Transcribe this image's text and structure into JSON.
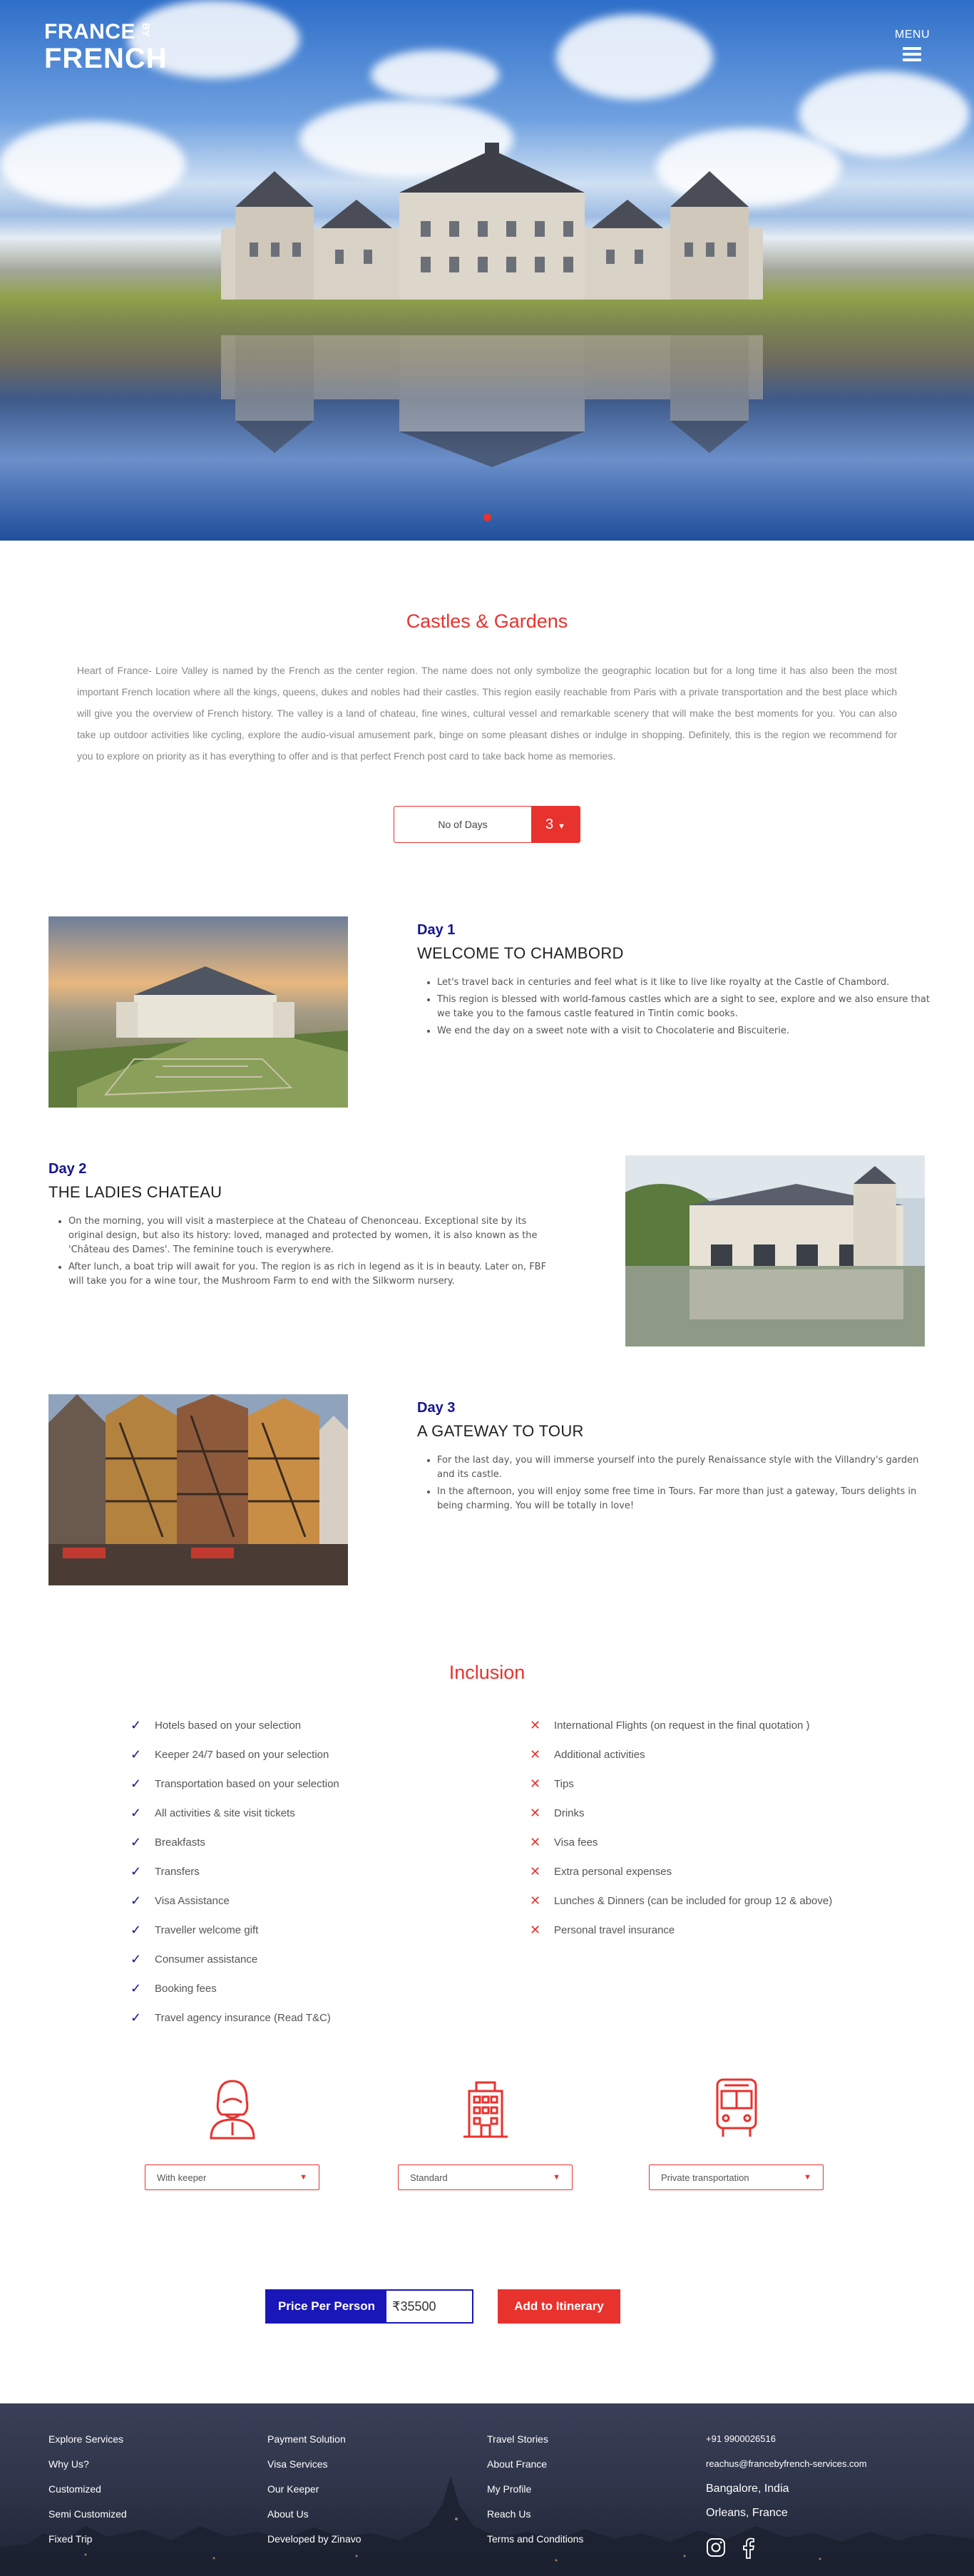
{
  "header": {
    "logo_line1": "FRANCE",
    "logo_by": "BY",
    "logo_line2": "FRENCH",
    "menu_label": "MENU"
  },
  "intro": {
    "title": "Castles & Gardens",
    "paragraph": "Heart of France- Loire Valley is named by the French as the center region. The name does not only symbolize the geographic location but for a long time it has also been the most important French location where all the kings, queens, dukes and nobles had their castles. This region easily reachable from Paris with a private transportation and the best place which will give you the overview of French history. The valley is a land of chateau, fine wines, cultural vessel and remarkable scenery that will make the best moments for you. You can also take up outdoor activities like cycling, explore the audio-visual amusement park, binge on some pleasant dishes or indulge in shopping. Definitely, this is the region we recommend for you to explore on priority as it has everything to offer and is that perfect French post card to take back home as memories.",
    "days_label": "No of Days",
    "days_value": "3"
  },
  "days": [
    {
      "num": "Day 1",
      "title": "WELCOME TO CHAMBORD",
      "bullets": [
        "Let's travel back in centuries and feel what is it like to live like royalty at the Castle of Chambord.",
        "This region is blessed with world-famous castles which are a sight to see, explore and we also ensure that we take you to the famous castle featured in Tintin comic books.",
        "We end the day on a sweet note with a visit to Chocolaterie and Biscuiterie."
      ]
    },
    {
      "num": "Day 2",
      "title": "THE LADIES CHATEAU",
      "bullets": [
        "On the morning, you will visit a masterpiece at the Chateau of Chenonceau. Exceptional site by its original design, but also its history: loved, managed and protected by women, it is also known as the 'Château des Dames'. The feminine touch is everywhere.",
        "After lunch, a boat trip will await for you. The region is as rich in legend as it is in beauty. Later on, FBF will take you for a wine tour, the Mushroom Farm to end with the Silkworm nursery."
      ]
    },
    {
      "num": "Day 3",
      "title": "A GATEWAY TO TOUR",
      "bullets": [
        "For the last day, you will immerse yourself into the purely Renaissance style with the Villandry's garden and its castle.",
        "In the afternoon, you will enjoy  some free time in Tours. Far more than just a gateway, Tours delights in being charming. You will be totally in love!"
      ]
    }
  ],
  "inclusion": {
    "title": "Inclusion",
    "included": [
      "Hotels based on your selection",
      "Keeper 24/7 based on your selection",
      "Transportation based on your selection",
      "All activities & site visit tickets",
      "Breakfasts",
      "Transfers",
      "Visa Assistance",
      "Traveller welcome gift",
      "Consumer assistance",
      "Booking fees",
      "Travel agency insurance (Read T&C)"
    ],
    "excluded": [
      "International Flights (on request in the final quotation )",
      "Additional activities",
      "Tips",
      "Drinks",
      "Visa fees",
      "Extra personal expenses",
      "Lunches & Dinners (can be included for group 12 & above)",
      "Personal travel insurance"
    ]
  },
  "options": {
    "keeper": "With keeper",
    "hotel": "Standard",
    "transport": "Private transportation"
  },
  "price": {
    "label": "Price Per Person",
    "value": "₹35500",
    "add_button": "Add to Itinerary"
  },
  "footer": {
    "col1": [
      "Explore Services",
      "Why Us?",
      "Customized",
      "Semi Customized",
      "Fixed Trip"
    ],
    "col2": [
      "Payment Solution",
      "Visa Services",
      "Our Keeper",
      "About Us",
      "Developed by Zinavo"
    ],
    "col3": [
      "Travel Stories",
      "About France",
      "My Profile",
      "Reach Us",
      "Terms and Conditions"
    ],
    "phone": "+91 9900026516",
    "email": "reachus@francebyfrench-services.com",
    "city1": "Bangalore, India",
    "city2": "Orleans, France"
  },
  "colors": {
    "accent": "#e8322e",
    "primary": "#1a17b8"
  }
}
